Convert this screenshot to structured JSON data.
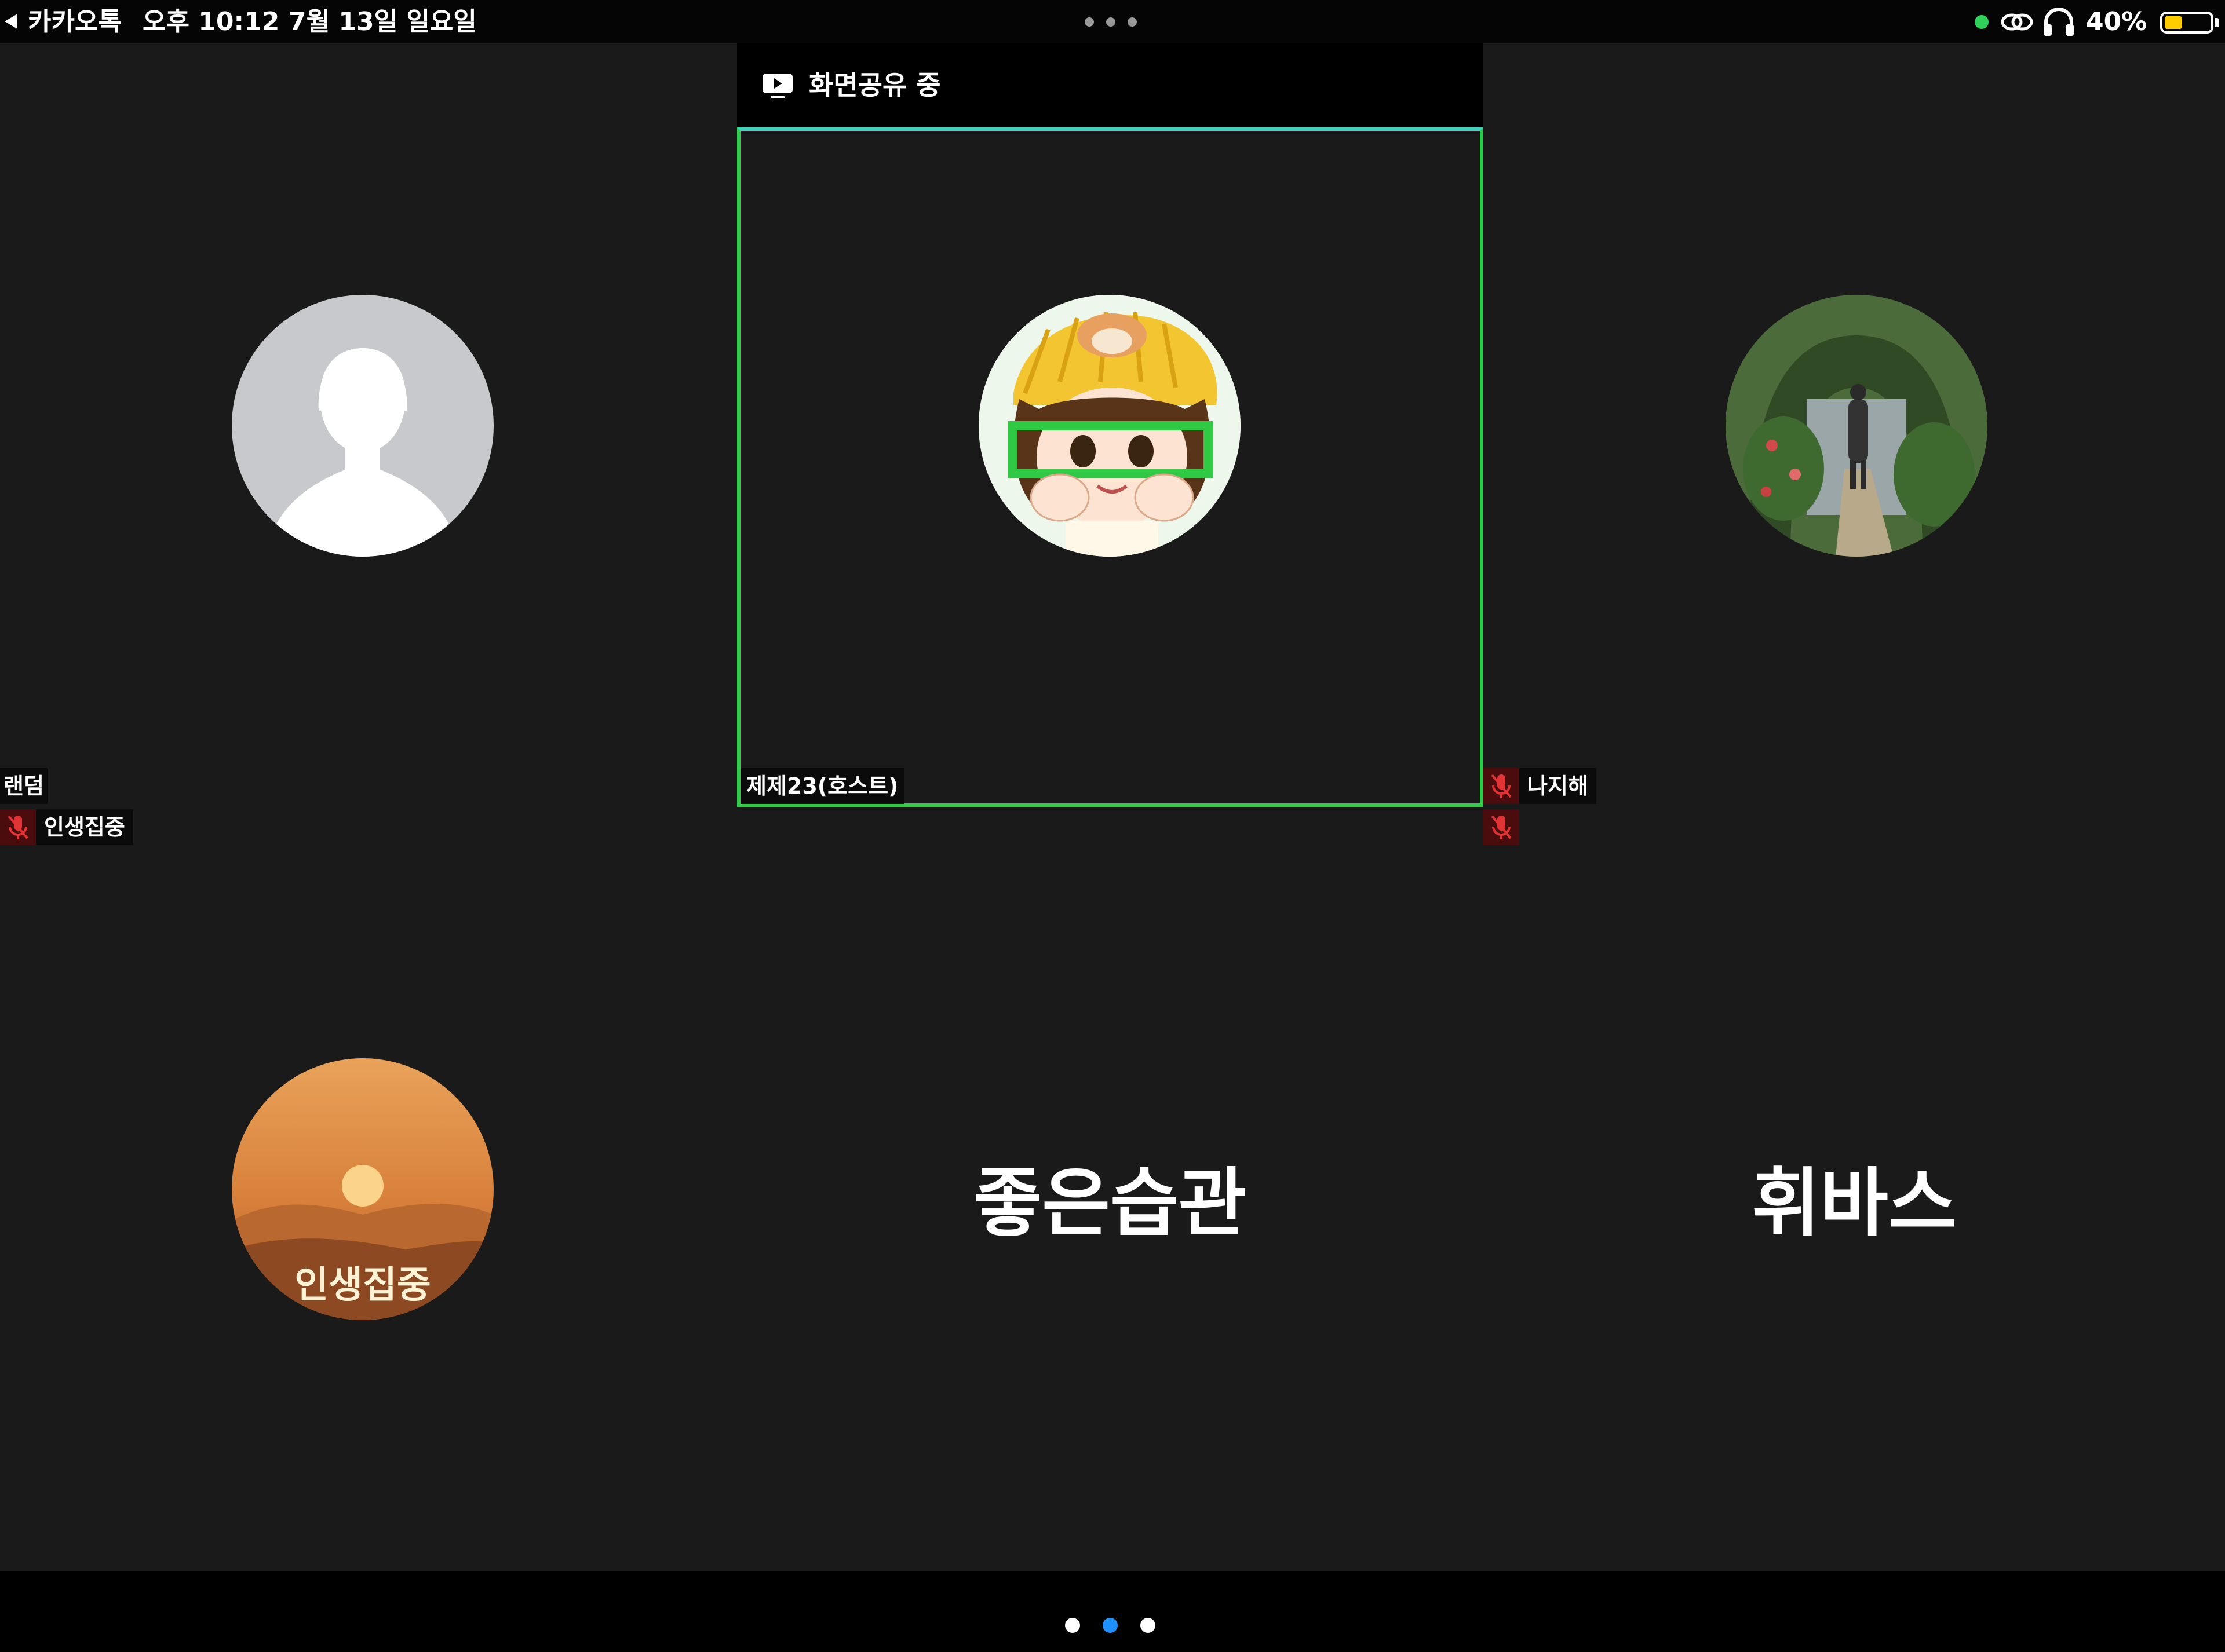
{
  "status_bar": {
    "back_app": "카카오톡",
    "time": "오후 10:12",
    "date": "7월 13일 일요일",
    "battery_percent_label": "40%",
    "battery_level": 0.4,
    "battery_color": "#ffcc00",
    "indicator_color": "#2fd158",
    "icons": [
      "back-arrow-icon",
      "more-icon",
      "link-icon",
      "headphone-icon",
      "battery-icon"
    ]
  },
  "share_banner": {
    "icon": "screen-share-icon",
    "label": "화면공유 중"
  },
  "participants": [
    {
      "name": "랜덤",
      "avatar": "default-person-icon",
      "muted": false
    },
    {
      "name": "제제23(호스트)",
      "avatar": "character-avatar",
      "muted": false,
      "active_speaker": true,
      "frame_color": "#2ecc4a"
    },
    {
      "name": "나지해",
      "avatar": "garden-path-photo",
      "muted": true
    },
    {
      "name": "인생집중",
      "avatar": "sunset-avatar",
      "avatar_text": "인생집중",
      "muted": true
    },
    {
      "name": "좋은습관",
      "avatar": null,
      "muted": true
    },
    {
      "name": "휘바스",
      "avatar": null,
      "muted": false
    }
  ],
  "pagination": {
    "pages": 3,
    "current": 2,
    "active_color": "#1e8fff"
  }
}
